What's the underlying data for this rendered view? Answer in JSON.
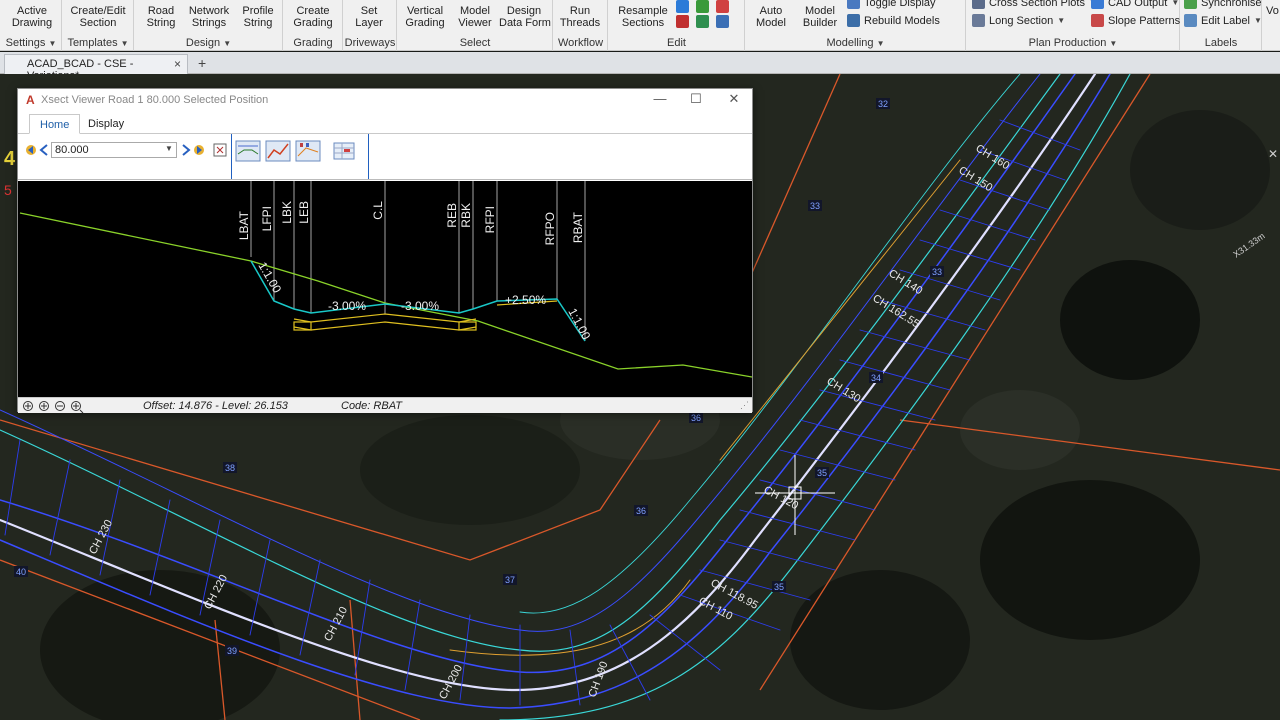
{
  "ribbon": {
    "buttons": {
      "active_drawing": [
        "Active",
        "Drawing"
      ],
      "create_edit_section": [
        "Create/Edit",
        "Section"
      ],
      "road_string": [
        "Road",
        "String"
      ],
      "network_strings": [
        "Network",
        "Strings"
      ],
      "profile_string": [
        "Profile",
        "String"
      ],
      "create_grading": [
        "Create",
        "Grading"
      ],
      "set_layer": [
        "Set",
        "Layer"
      ],
      "vertical_grading": [
        "Vertical",
        "Grading"
      ],
      "model_viewer": [
        "Model",
        "Viewer"
      ],
      "design_data_form": [
        "Design",
        "Data Form"
      ],
      "run_threads": [
        "Run",
        "Threads"
      ],
      "resample_sections": [
        "Resample",
        "Sections"
      ],
      "auto_model": [
        "Auto",
        "Model"
      ],
      "model_builder": [
        "Model",
        "Builder"
      ]
    },
    "small_buttons": {
      "toggle_display": "Toggle Display",
      "rebuild_models": "Rebuild Models",
      "cross_section_plots": "Cross Section Plots",
      "long_section": "Long  Section",
      "cad_output": "CAD Output",
      "slope_patterns": "Slope Patterns",
      "synchronise": "Synchronise",
      "edit_label": "Edit Label",
      "vo": "Vo"
    },
    "groups": {
      "settings": "Settings",
      "templates": "Templates",
      "design": "Design",
      "grading": "Grading",
      "driveways": "Driveways",
      "select": "Select",
      "workflow": "Workflow",
      "edit": "Edit",
      "modelling": "Modelling",
      "plan_production": "Plan Production",
      "labels": "Labels"
    }
  },
  "document_tab": {
    "title": "ACAD_BCAD - CSE - Variations*",
    "close": "×",
    "new_tab": "+"
  },
  "xsect_viewer": {
    "title": "Xsect Viewer Road 1  80.000 Selected Position",
    "tabs": [
      "Home",
      "Display"
    ],
    "chainage_value": "80.000",
    "section_codes": [
      "LBAT",
      "LFPI",
      "LBK",
      "LEB",
      "C.L",
      "REB",
      "RBK",
      "RFPI",
      "RFPO",
      "RBAT"
    ],
    "slope_labels": [
      "1:1.00",
      "-3.00%",
      "-3.00%",
      "+2.50%",
      "1:1.00"
    ],
    "status": {
      "offset_level": "Offset: 14.876 - Level: 26.153",
      "code": "Code: RBAT"
    }
  },
  "map": {
    "chainage_labels": [
      "CH 160",
      "CH 150",
      "CH 162.55",
      "CH 140",
      "CH 130",
      "CH 120",
      "CH 118.95",
      "CH 110",
      "CH 230",
      "CH 220",
      "CH 210",
      "CH 200",
      "CH 190"
    ],
    "segment_numbers": [
      "32",
      "33",
      "34",
      "35",
      "36",
      "37",
      "38",
      "39",
      "40",
      "36",
      "35",
      "33"
    ],
    "dimension_label": "X31.33m",
    "side_marks": [
      "4",
      "5"
    ]
  },
  "colors": {
    "ribbon_bg": "#f0f0f0",
    "string_blue": "#3a4dff",
    "string_cyan": "#3ad8d8",
    "boundary_orange": "#e0602a",
    "section_green": "#8ad22a",
    "section_cyan": "#19c8c8",
    "section_yellow": "#e0c020",
    "active_tab": "#1f5fa8"
  }
}
